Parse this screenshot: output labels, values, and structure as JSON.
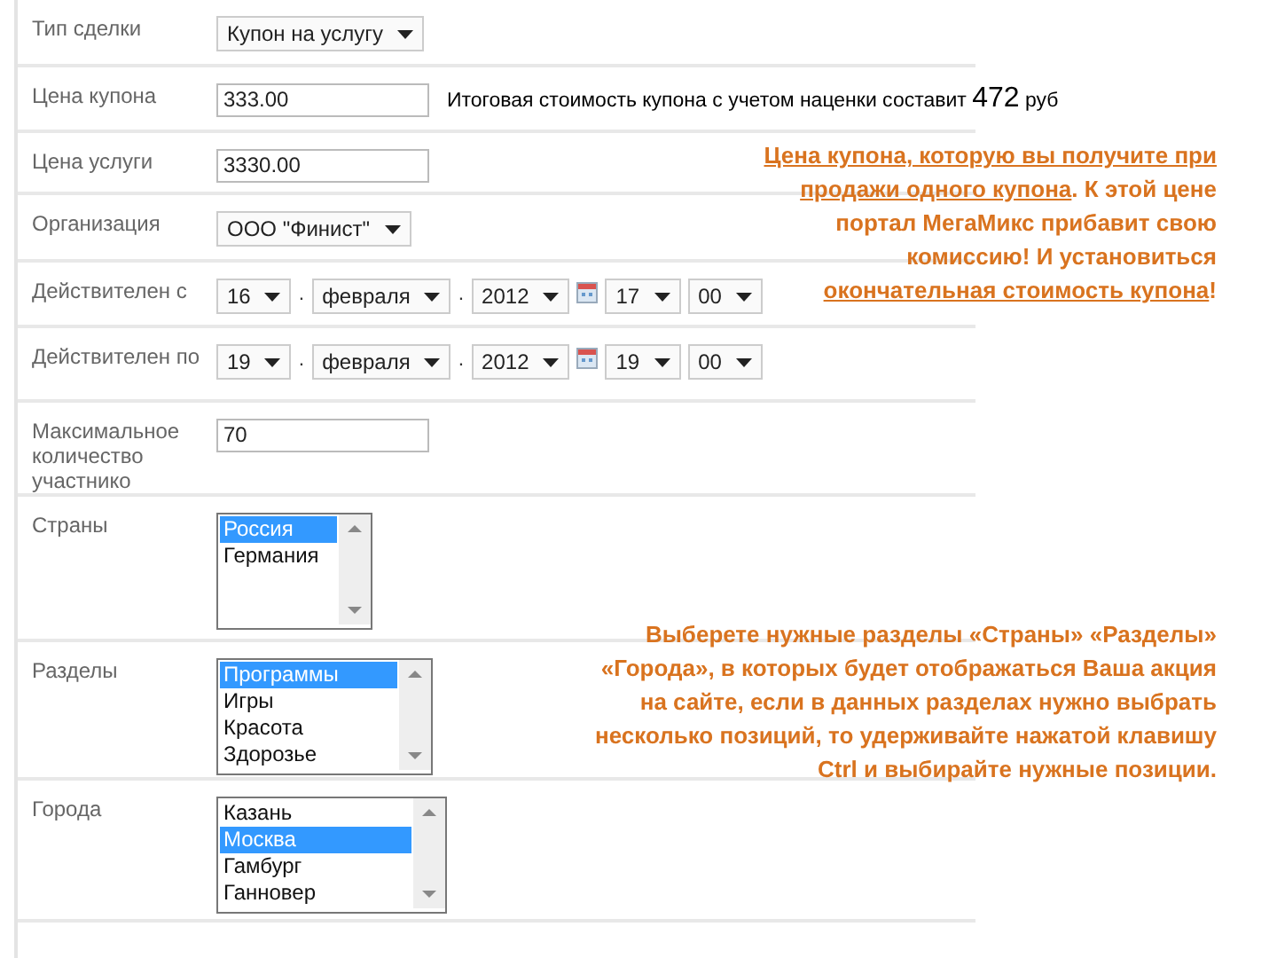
{
  "rows": [
    {
      "label": "Тип сделки",
      "kind": "select",
      "value": "Купон на услугу"
    },
    {
      "label": "Цена купона",
      "kind": "price",
      "value": "333.00",
      "note": {
        "text": "Итоговая стоимость купона с учетом наценки составит",
        "amount": "472",
        "currency": "руб"
      }
    },
    {
      "label": "Цена услуги",
      "kind": "input",
      "value": "3330.00"
    },
    {
      "label": "Организация",
      "kind": "select",
      "value": "ООО \"Финист\""
    },
    {
      "label": "Действителен с",
      "kind": "date",
      "day": "16",
      "sep1": ".",
      "month": "февраля",
      "sep2": ".",
      "year": "2012",
      "hour": "17",
      "minute": "00"
    },
    {
      "label": "Действителен по",
      "kind": "date",
      "day": "19",
      "sep1": ".",
      "month": "февраля",
      "sep2": ".",
      "year": "2012",
      "hour": "19",
      "minute": "00"
    },
    {
      "label": "Максимальное количество участнико",
      "kind": "input",
      "value": "70"
    },
    {
      "label": "Страны",
      "kind": "list",
      "options": [
        {
          "text": "Россия",
          "selected": true
        },
        {
          "text": "Германия",
          "selected": false
        }
      ]
    },
    {
      "label": "Разделы",
      "kind": "list",
      "options": [
        {
          "text": "Программы",
          "selected": true
        },
        {
          "text": "Игры",
          "selected": false
        },
        {
          "text": "Красота",
          "selected": false
        },
        {
          "text": "Здорозье",
          "selected": false
        }
      ]
    },
    {
      "label": "Города",
      "kind": "list",
      "options": [
        {
          "text": "Казань",
          "selected": false
        },
        {
          "text": "Москва",
          "selected": true
        },
        {
          "text": "Гамбург",
          "selected": false
        },
        {
          "text": "Ганновер",
          "selected": false
        }
      ]
    }
  ],
  "annotations": [
    {
      "parts": [
        {
          "text": "Цена купона, которую вы получите при продажи одного купона",
          "underline": true
        },
        {
          "text": ". К этой цене портал МегаМикс прибавит свою комиссию! И установиться ",
          "underline": false
        },
        {
          "text": "окончательная стоимость купона",
          "underline": true
        },
        {
          "text": "!",
          "underline": false
        }
      ]
    },
    {
      "parts": [
        {
          "text": "Выберете нужные разделы  «Страны» «Разделы» «Города», в которых будет отображаться Ваша акция на сайте, если в данных  разделах нужно выбрать несколько позиций, то удерживайте нажатой клавишу Ctrl и выбирайте нужные позиции.",
          "underline": false
        }
      ]
    }
  ]
}
